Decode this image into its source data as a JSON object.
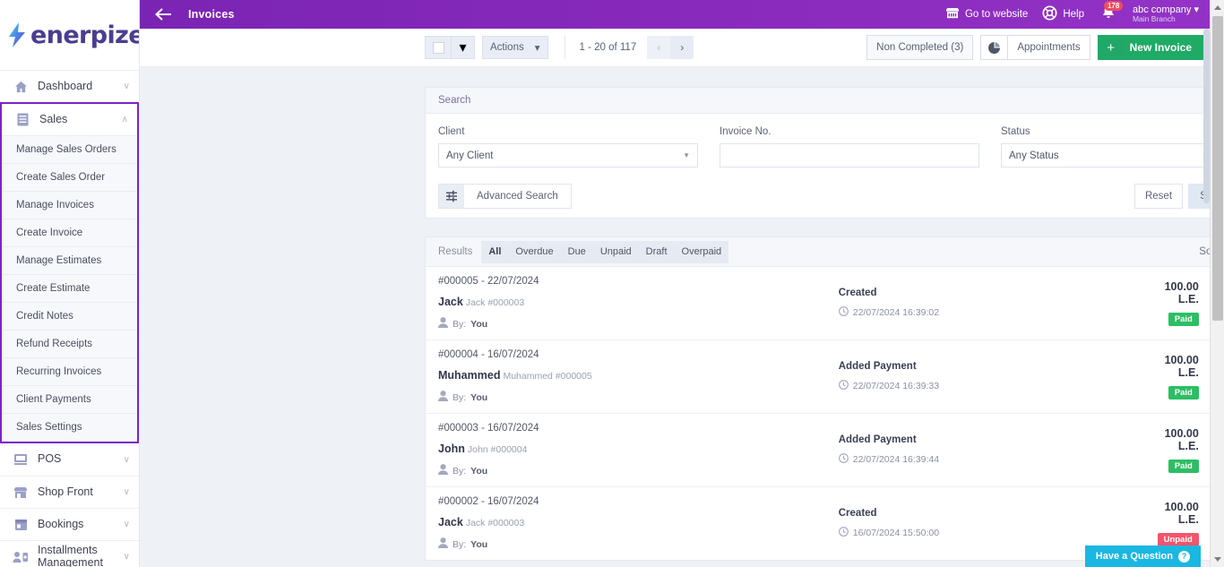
{
  "brand": {
    "name": "enerpize",
    "accent": "#7b24b3",
    "green": "#1faa66",
    "cyan": "#1ab7e2"
  },
  "sidebar": {
    "groups": [
      {
        "label": "Dashboard",
        "icon": "home-icon",
        "chevron": "∨",
        "active": false,
        "items": []
      },
      {
        "label": "Sales",
        "icon": "list-icon",
        "chevron": "∧",
        "active": true,
        "items": [
          "Manage Sales Orders",
          "Create Sales Order",
          "Manage Invoices",
          "Create Invoice",
          "Manage Estimates",
          "Create Estimate",
          "Credit Notes",
          "Refund Receipts",
          "Recurring Invoices",
          "Client Payments",
          "Sales Settings"
        ]
      },
      {
        "label": "POS",
        "icon": "monitor-icon",
        "chevron": "∨",
        "active": false,
        "items": []
      },
      {
        "label": "Shop Front",
        "icon": "store-icon",
        "chevron": "∨",
        "active": false,
        "items": []
      },
      {
        "label": "Bookings",
        "icon": "calendar-icon",
        "chevron": "∨",
        "active": false,
        "items": []
      },
      {
        "label": "Installments Management",
        "icon": "people-icon",
        "chevron": "∨",
        "active": false,
        "items": []
      }
    ]
  },
  "topbar": {
    "collapse_icon": "collapse-sidebar-icon",
    "title": "Invoices",
    "website_label": "Go to website",
    "website_icon": "storefront-icon",
    "help_label": "Help",
    "help_icon": "lifebuoy-icon",
    "bell_icon": "notification-bell-icon",
    "bell_count": "178",
    "company_name": "abc company",
    "company_branch": "Main Branch"
  },
  "toolbar": {
    "select_all_icon": "checkbox-icon",
    "select_caret": "▾",
    "actions_label": "Actions",
    "actions_caret": "▾",
    "pagination": "1 - 20 of 117",
    "prev": "‹",
    "next": "›",
    "non_completed_label": "Non Completed (3)",
    "appointments_icon": "pie-chart-icon",
    "appointments_label": "Appointments",
    "new_invoice_plus": "+",
    "new_invoice_label": "New Invoice"
  },
  "search": {
    "title": "Search",
    "client_label": "Client",
    "client_value": "Any Client",
    "invoice_label": "Invoice No.",
    "invoice_value": "",
    "status_label": "Status",
    "status_value": "Any Status",
    "advanced_icon": "sliders-icon",
    "advanced_label": "Advanced Search",
    "reset_label": "Reset",
    "search_label": "Search"
  },
  "results": {
    "label": "Results",
    "tabs": [
      {
        "label": "All",
        "active": true
      },
      {
        "label": "Overdue",
        "active": false
      },
      {
        "label": "Due",
        "active": false
      },
      {
        "label": "Unpaid",
        "active": false
      },
      {
        "label": "Draft",
        "active": false
      },
      {
        "label": "Overpaid",
        "active": false
      }
    ],
    "sort_label": "Sort By",
    "sort_icon": "sort-updown-icon",
    "by_prefix": "By:",
    "by_icon": "user-icon",
    "time_icon": "clock-icon",
    "more_icon": "ellipsis-icon",
    "rows": [
      {
        "number": "#000005 - 22/07/2024",
        "client_name": "Jack",
        "client_ref": "Jack #000003",
        "by": "You",
        "activity": "Created",
        "timestamp": "22/07/2024 16:39:02",
        "amount": "100.00 L.E.",
        "status": "Paid",
        "status_kind": "paid"
      },
      {
        "number": "#000004 - 16/07/2024",
        "client_name": "Muhammed",
        "client_ref": "Muhammed #000005",
        "by": "You",
        "activity": "Added Payment",
        "timestamp": "22/07/2024 16:39:33",
        "amount": "100.00 L.E.",
        "status": "Paid",
        "status_kind": "paid"
      },
      {
        "number": "#000003 - 16/07/2024",
        "client_name": "John",
        "client_ref": "John #000004",
        "by": "You",
        "activity": "Added Payment",
        "timestamp": "22/07/2024 16:39:44",
        "amount": "100.00 L.E.",
        "status": "Paid",
        "status_kind": "paid"
      },
      {
        "number": "#000002 - 16/07/2024",
        "client_name": "Jack",
        "client_ref": "Jack #000003",
        "by": "You",
        "activity": "Created",
        "timestamp": "16/07/2024 15:50:00",
        "amount": "100.00 L.E.",
        "status": "Unpaid",
        "status_kind": "unpaid"
      }
    ]
  },
  "help_widget": {
    "label": "Have a Question",
    "icon": "question-mark-icon",
    "mark": "?"
  }
}
